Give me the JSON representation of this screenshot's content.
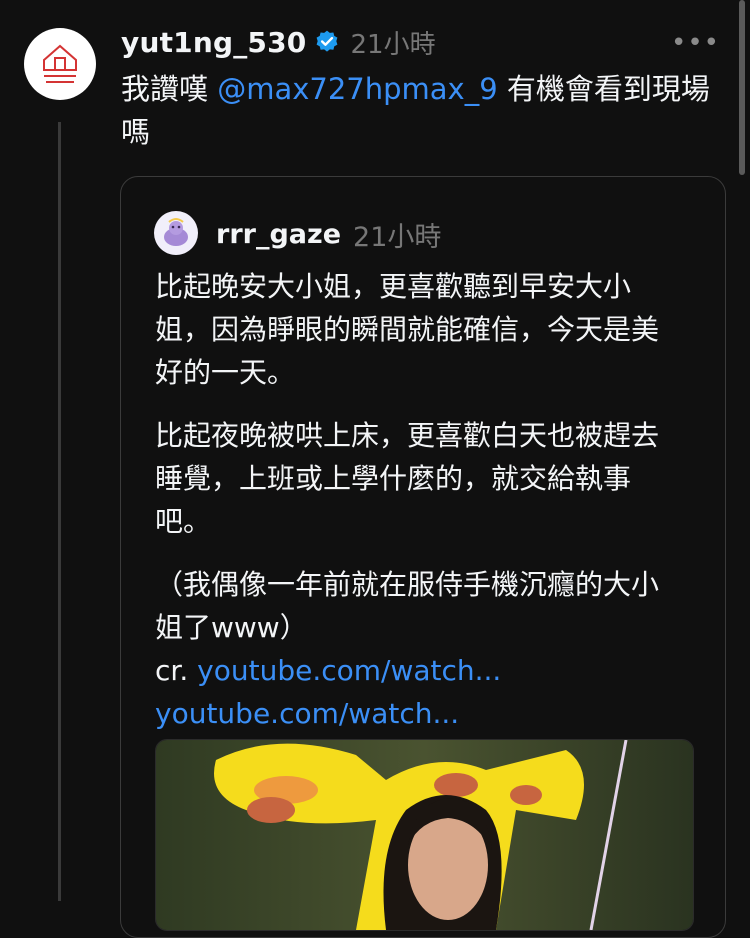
{
  "post": {
    "username": "yut1ng_530",
    "time": "21小時",
    "more_label": "•••",
    "text_before": "我讚嘆 ",
    "mention": "@max727hpmax_9",
    "text_after": " 有機會看到現場嗎"
  },
  "quote": {
    "username": "rrr_gaze",
    "time": "21小時",
    "para1": "比起晚安大小姐，更喜歡聽到早安大小姐，因為睜眼的瞬間就能確信，今天是美好的一天。",
    "para2": "比起夜晚被哄上床，更喜歡白天也被趕去睡覺，上班或上學什麼的，就交給執事吧。",
    "para3": "（我偶像一年前就在服侍手機沉癮的大小姐了www）",
    "cr_label": "cr. ",
    "link1": "youtube.com/watch...",
    "link2": "youtube.com/watch..."
  },
  "icons": {
    "verified": "verified-badge-icon",
    "more": "more-options-icon"
  },
  "colors": {
    "background": "#101010",
    "link": "#3b8ff6",
    "verified": "#1d9bf0"
  }
}
